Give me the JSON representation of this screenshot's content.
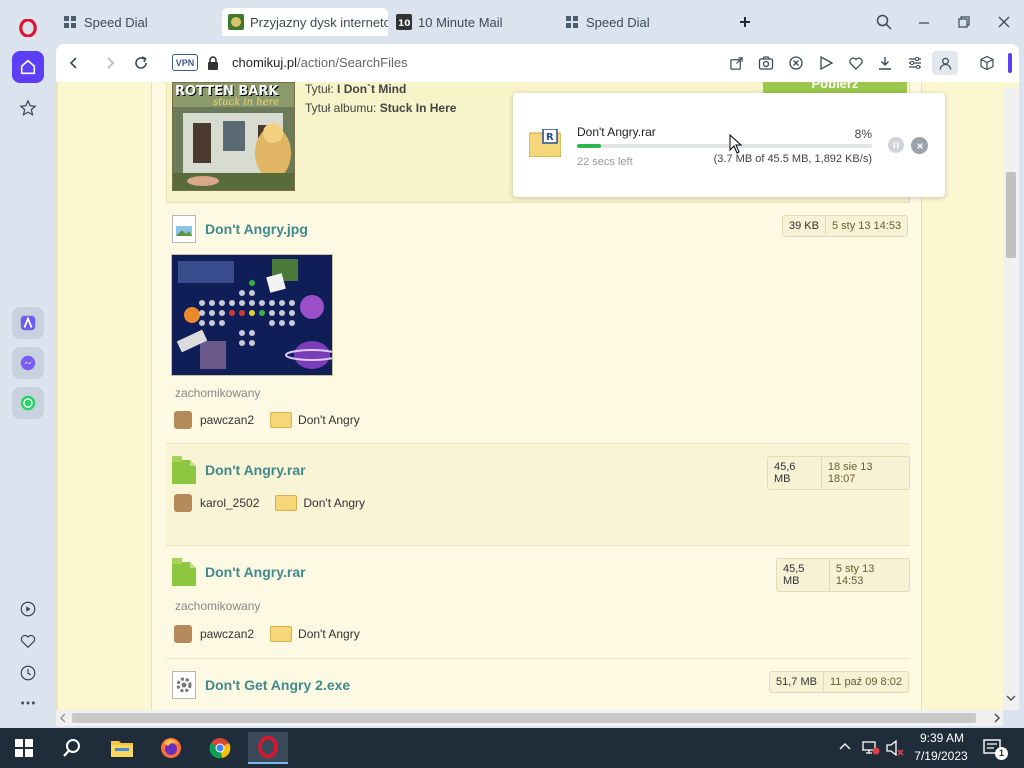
{
  "browser": {
    "tabs": [
      {
        "label": "Speed Dial",
        "icon": "grid-icon"
      },
      {
        "label": "Przyjazny dysk internetow",
        "icon": "chomikuj-icon",
        "active": true
      },
      {
        "label": "10 Minute Mail",
        "icon": "ten-icon"
      },
      {
        "label": "Speed Dial",
        "icon": "grid-icon"
      }
    ],
    "vpn_label": "VPN",
    "url_host": "chomikuj.pl",
    "url_path": "/action/SearchFiles"
  },
  "album": {
    "cover_title": "ROTTEN BARK",
    "cover_subtitle": "stuck in here",
    "title_label": "Tytuł:",
    "title_value": "I Don`t Mind",
    "album_label": "Tytuł albumu:",
    "album_value": "Stuck In Here",
    "download_button": "Pobierz"
  },
  "download": {
    "filename": "Don't Angry.rar",
    "percent": "8%",
    "progress": 0.08,
    "time_left": "22 secs left",
    "status": "(3.7 MB of 45.5 MB, 1,892 KB/s)"
  },
  "files": [
    {
      "name": "Don't Angry.jpg",
      "size": "39 KB",
      "date": "5 sty 13 14:53",
      "type": "image",
      "status": "zachomikowany",
      "user": "pawczan2",
      "folder": "Don't Angry"
    },
    {
      "name": "Don't Angry.rar",
      "size": "45,6 MB",
      "date": "18 sie 13 18:07",
      "type": "archive",
      "user": "karol_2502",
      "folder": "Don't Angry"
    },
    {
      "name": "Don't Angry.rar",
      "size": "45,5 MB",
      "date": "5 sty 13 14:53",
      "type": "archive",
      "status": "zachomikowany",
      "user": "pawczan2",
      "folder": "Don't Angry"
    },
    {
      "name": "Don't Get Angry 2.exe",
      "size": "51,7 MB",
      "date": "11 paź 09 8:02",
      "type": "exe"
    }
  ],
  "taskbar": {
    "time": "9:39 AM",
    "date": "7/19/2023",
    "notification_count": "1"
  }
}
